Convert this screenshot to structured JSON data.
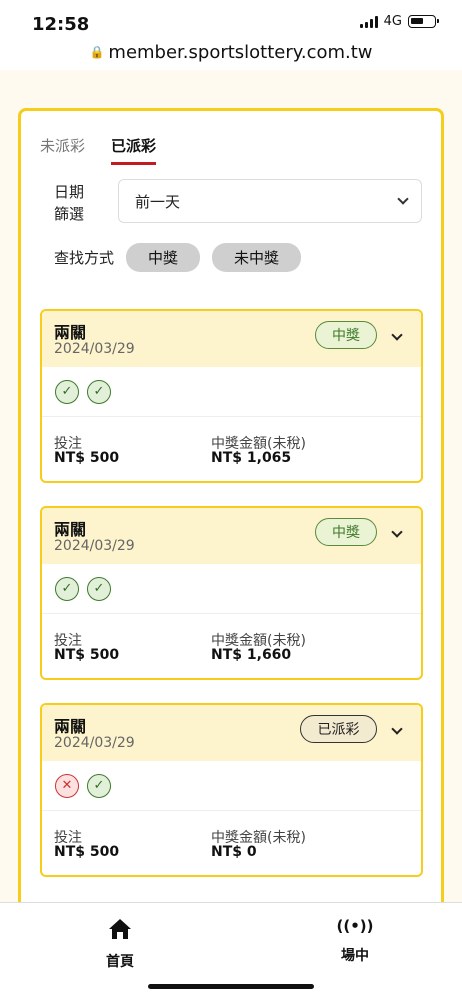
{
  "status_bar": {
    "time": "12:58",
    "network": "4G",
    "url": "member.sportslottery.com.tw"
  },
  "tabs": [
    {
      "label": "未派彩",
      "active": false
    },
    {
      "label": "已派彩",
      "active": true
    }
  ],
  "filter": {
    "date_label": "日期篩選",
    "date_value": "前一天",
    "search_label": "查找方式",
    "search_options": [
      "中獎",
      "未中獎"
    ]
  },
  "cards": [
    {
      "title": "兩關",
      "date": "2024/03/29",
      "status": "中獎",
      "results": [
        "win",
        "win"
      ],
      "bet_label": "投注",
      "bet_value": "NT$ 500",
      "prize_label": "中獎金額(未稅)",
      "prize_value": "NT$ 1,065"
    },
    {
      "title": "兩關",
      "date": "2024/03/29",
      "status": "中獎",
      "results": [
        "win",
        "win"
      ],
      "bet_label": "投注",
      "bet_value": "NT$ 500",
      "prize_label": "中獎金額(未稅)",
      "prize_value": "NT$ 1,660"
    },
    {
      "title": "兩關",
      "date": "2024/03/29",
      "status": "已派彩",
      "results": [
        "lose",
        "win"
      ],
      "bet_label": "投注",
      "bet_value": "NT$ 500",
      "prize_label": "中獎金額(未稅)",
      "prize_value": "NT$ 0"
    }
  ],
  "bottom_nav": [
    {
      "label": "首頁",
      "icon": "home-icon"
    },
    {
      "label": "場中",
      "icon": "live-broadcast-icon"
    }
  ],
  "colors": {
    "accent": "#f5cd1a",
    "active_tab_underline": "#c21b22",
    "win_green": "#3f7a2a",
    "lose_red": "#cc3333"
  }
}
